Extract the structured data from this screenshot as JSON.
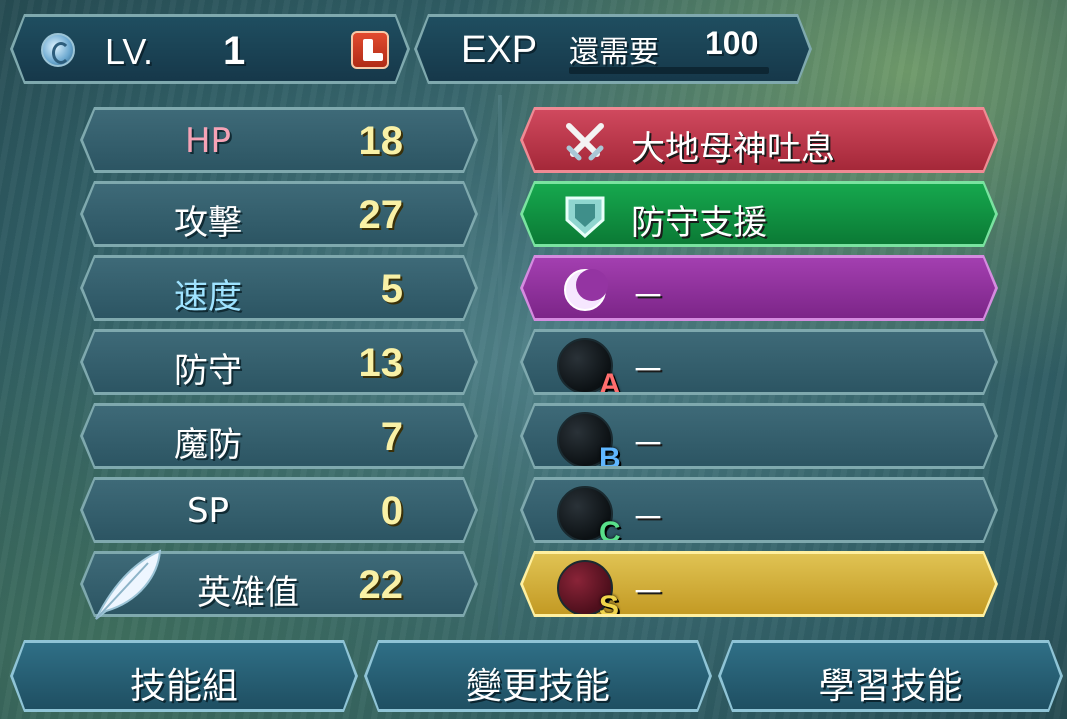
{
  "header": {
    "level_label": "LV.",
    "level_value": "1",
    "exp_label": "EXP",
    "exp_need_label": "還需要",
    "exp_need_value": "100",
    "level_icon": "water-drop-icon",
    "move_icon": "boot-icon"
  },
  "stats": [
    {
      "label": "HP",
      "value": "18",
      "label_color": "#f6a3b6"
    },
    {
      "label": "攻擊",
      "value": "27",
      "label_color": "#ffffff"
    },
    {
      "label": "速度",
      "value": "5",
      "label_color": "#9fe3ff"
    },
    {
      "label": "防守",
      "value": "13",
      "label_color": "#ffffff"
    },
    {
      "label": "魔防",
      "value": "7",
      "label_color": "#ffffff"
    },
    {
      "label": "SP",
      "value": "0",
      "label_color": "#ffffff"
    },
    {
      "label": "英雄值",
      "value": "22",
      "label_color": "#ffffff"
    }
  ],
  "skills": [
    {
      "type": "weapon",
      "text": "大地母神吐息",
      "icon": "crossed-swords-icon",
      "color": "#c23b50"
    },
    {
      "type": "assist",
      "text": "防守支援",
      "icon": "shield-icon",
      "color": "#13994a"
    },
    {
      "type": "special",
      "text": "－",
      "icon": "crescent-moon-icon",
      "color": "#9434a2"
    },
    {
      "type": "A",
      "text": "－",
      "letter": "A",
      "letter_color": "#ff6e6e"
    },
    {
      "type": "B",
      "text": "－",
      "letter": "B",
      "letter_color": "#5fb6ff"
    },
    {
      "type": "C",
      "text": "－",
      "letter": "C",
      "letter_color": "#58e08a"
    },
    {
      "type": "S",
      "text": "－",
      "letter": "S",
      "letter_color": "#f0d44a"
    }
  ],
  "buttons": {
    "skill_set": "技能組",
    "change_skill": "變更技能",
    "learn_skill": "學習技能"
  },
  "colors": {
    "stat_value": "#f9f1a6",
    "panel_border": "#7fa9ae"
  }
}
